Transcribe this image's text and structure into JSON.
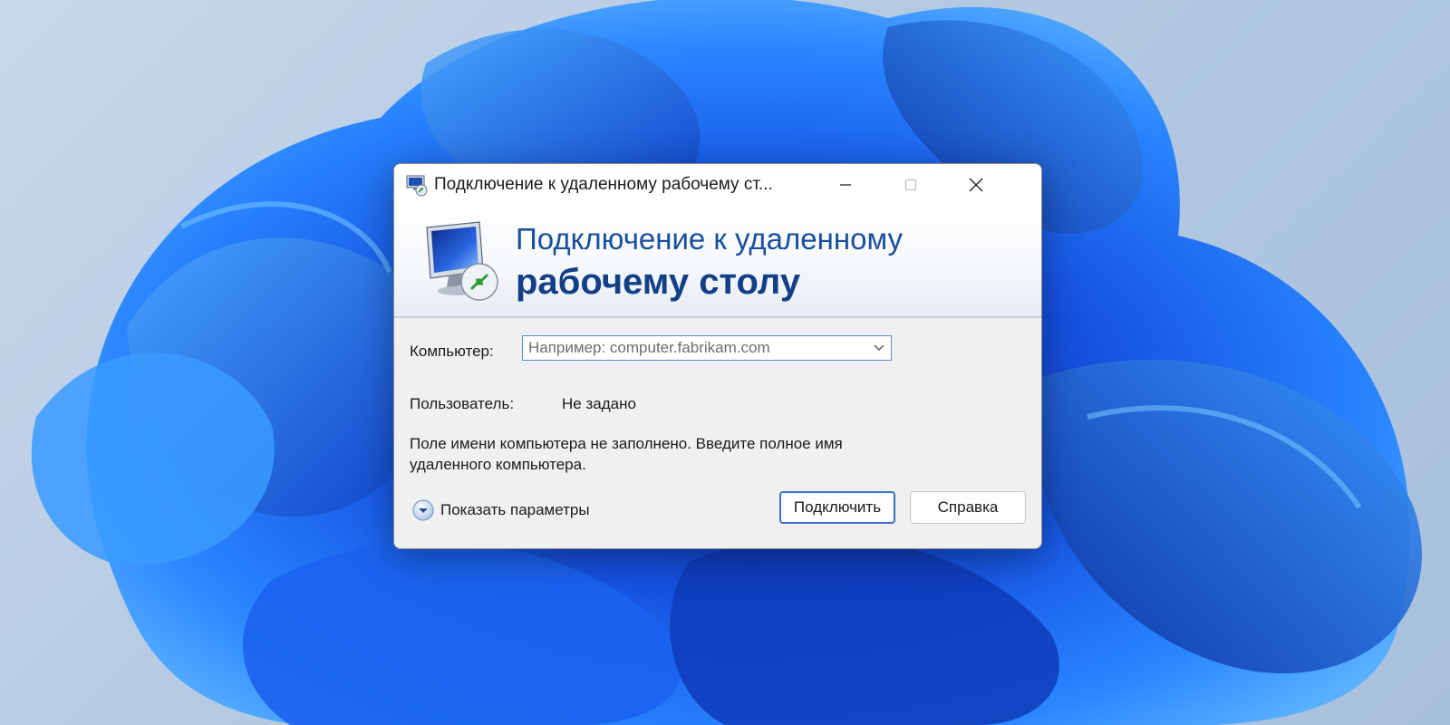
{
  "window": {
    "title": "Подключение к удаленному рабочему ст..."
  },
  "banner": {
    "line1": "Подключение к удаленному",
    "line2": "рабочему столу"
  },
  "form": {
    "computer_label": "Компьютер:",
    "computer_value": "",
    "computer_placeholder": "Например: computer.fabrikam.com",
    "user_label": "Пользователь:",
    "user_value": "Не задано",
    "status_message": "Поле имени компьютера не заполнено. Введите полное имя удаленного компьютера."
  },
  "footer": {
    "show_options_label": "Показать параметры",
    "connect_label": "Подключить",
    "help_label": "Справка"
  },
  "colors": {
    "accent": "#3a72c6",
    "banner_title": "#1a4f9c",
    "wallpaper_blue": "#1f6cf0"
  },
  "icons": {
    "title": "remote-desktop-icon",
    "banner": "remote-desktop-icon",
    "minimize": "minimize-icon",
    "maximize": "maximize-icon",
    "close": "close-icon",
    "combo_arrow": "chevron-down-icon",
    "expander": "chevron-down-circle-icon"
  }
}
